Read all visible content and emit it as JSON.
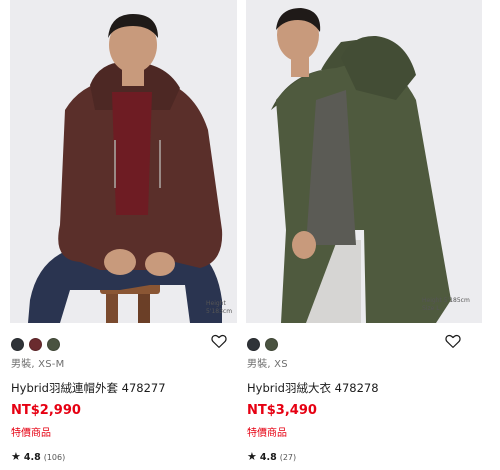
{
  "products": [
    {
      "size_note": "Height 5'183cm",
      "swatches": [
        "#2f3338",
        "#6a2b2e",
        "#4a5340"
      ],
      "gender": "男裝, XS-M",
      "title": "Hybrid羽絨連帽外套 478277",
      "price": "NT$2,990",
      "badge": "特價商品",
      "rating_star": "★",
      "rating": "4.8",
      "review_count": "(106)",
      "favorite_icon": "heart-outline-icon"
    },
    {
      "size_note": "Height 5'185cm Size L",
      "swatches": [
        "#2f3338",
        "#4a5340"
      ],
      "gender": "男裝, XS",
      "title": "Hybrid羽絨大衣 478278",
      "price": "NT$3,490",
      "badge": "特價商品",
      "rating_star": "★",
      "rating": "4.8",
      "review_count": "(27)",
      "favorite_icon": "heart-outline-icon"
    }
  ]
}
